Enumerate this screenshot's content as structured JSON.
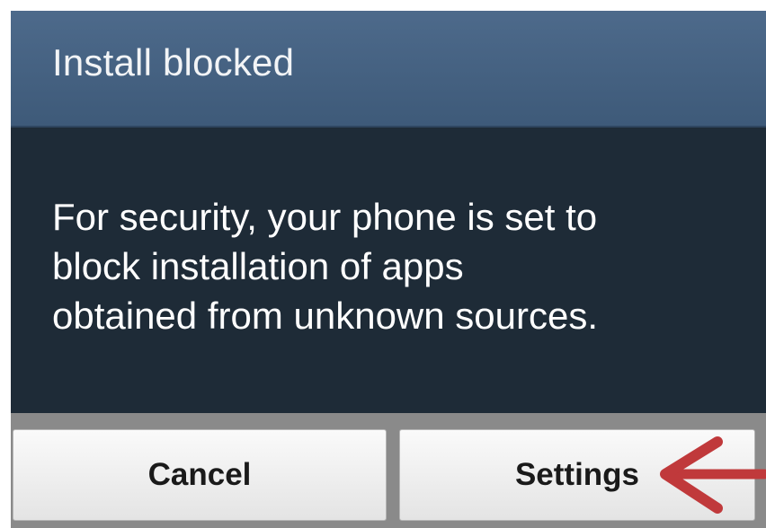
{
  "dialog": {
    "title": "Install blocked",
    "message": "For security, your phone is set to\nblock installation of apps\nobtained from unknown sources.",
    "buttons": {
      "cancel_label": "Cancel",
      "settings_label": "Settings"
    }
  },
  "annotation": {
    "arrow_color": "#c0393b",
    "points_to": "settings-button"
  },
  "colors": {
    "title_bar": "#46627f",
    "body": "#1e2b37",
    "button_bar": "#8a8a8a"
  }
}
